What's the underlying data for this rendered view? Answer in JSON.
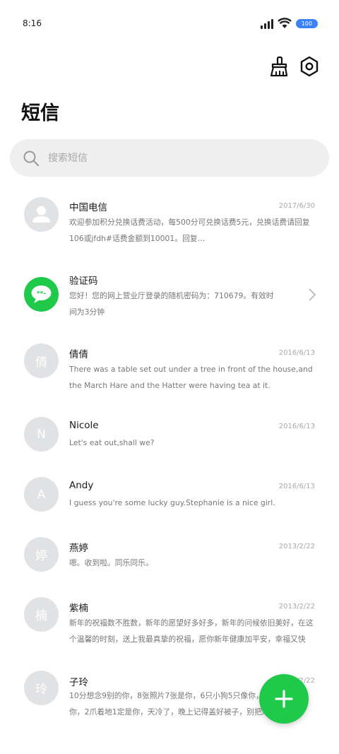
{
  "status": {
    "time": "8:16",
    "battery": "100"
  },
  "header": {
    "title": "短信"
  },
  "search": {
    "placeholder": "搜索短信"
  },
  "colors": {
    "accent": "#1fc94a",
    "avatar_bg": "#e1e2e4",
    "battery": "#3b82f6"
  },
  "threads": [
    {
      "avatar_icon": "person-icon",
      "avatar_text": "",
      "sender": "中国电信",
      "date": "2017/6/30",
      "preview": "欢迎参加积分兑换话费活动，每500分可兑换话费5元，兑换话费请回复106或jfdh#话费金额到10001。回复…"
    },
    {
      "avatar_icon": "message-bubble-icon",
      "avatar_text": "",
      "sender": "验证码",
      "date": "",
      "preview": "您好！您的网上营业厅登录的随机密码为：710679。有效时间为3分钟"
    },
    {
      "avatar_text": "倩",
      "sender": "倩倩",
      "date": "2016/6/13",
      "preview": "There was a table set out under a tree in front of the house,and the March Hare and the Hatter were having tea at it."
    },
    {
      "avatar_text": "N",
      "sender": "Nicole",
      "date": "2016/6/13",
      "preview": "Let's eat out,shall we?"
    },
    {
      "avatar_text": "A",
      "sender": "Andy",
      "date": "2016/6/13",
      "preview": "I guess you're some lucky guy.Stephanie is a nice girl."
    },
    {
      "avatar_text": "婷",
      "sender": "燕婷",
      "date": "2013/2/22",
      "preview": "嗯。收到啦。同乐同乐。"
    },
    {
      "avatar_text": "楠",
      "sender": "紫楠",
      "date": "2013/2/22",
      "preview": "新年的祝福数不胜数，新年的愿望好多好多，新年的问候依旧美好，在这个温馨的时刻，送上我最真挚的祝福，愿你新年健康加平安，幸福又快乐！"
    },
    {
      "avatar_text": "玲",
      "sender": "子玲",
      "date": "2013/2/22",
      "preview": "10分想念9别的你，8张照片7张是你，6只小狗5只像你，4杯水3杯给你，2爪着地1定是你，天冷了，晚上记得盖好被子，别把爪子给冻了。"
    }
  ]
}
